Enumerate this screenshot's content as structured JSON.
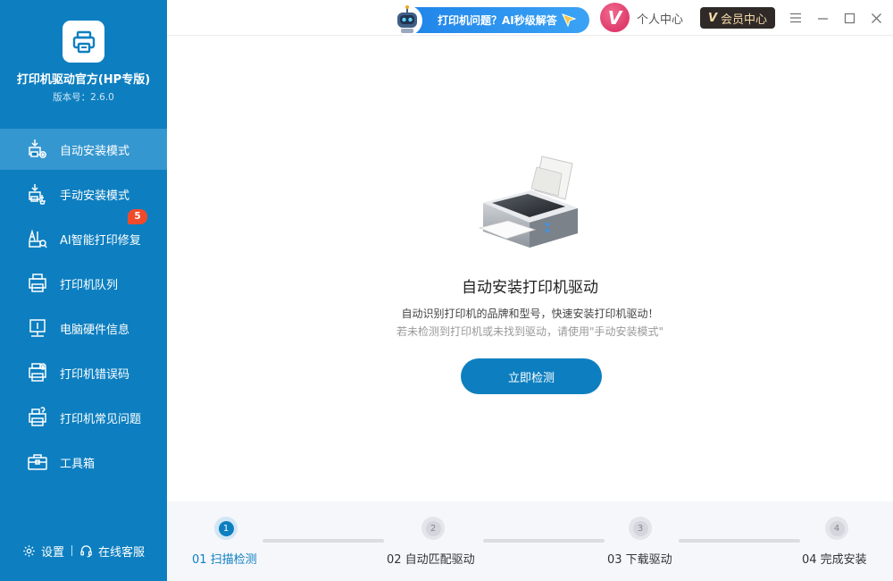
{
  "app": {
    "title": "打印机驱动官方(HP专版)",
    "version_label": "版本号：",
    "version_value": "2.6.0"
  },
  "sidebar": {
    "items": [
      {
        "label": "自动安装模式",
        "icon": "auto-install-icon",
        "active": true
      },
      {
        "label": "手动安装模式",
        "icon": "manual-install-icon"
      },
      {
        "label": "AI智能打印修复",
        "icon": "ai-repair-icon",
        "badge": "5"
      },
      {
        "label": "打印机队列",
        "icon": "printer-queue-icon"
      },
      {
        "label": "电脑硬件信息",
        "icon": "hardware-info-icon"
      },
      {
        "label": "打印机错误码",
        "icon": "printer-error-icon"
      },
      {
        "label": "打印机常见问题",
        "icon": "printer-faq-icon"
      },
      {
        "label": "工具箱",
        "icon": "toolbox-icon"
      }
    ],
    "footer": {
      "settings_label": "设置",
      "support_label": "在线客服"
    }
  },
  "topbar": {
    "ai_banner_text": "打印机问题？AI秒级解答",
    "avatar_letter": "V",
    "user_center_label": "个人中心",
    "vip_badge": "V",
    "vip_label": "会员中心"
  },
  "main": {
    "title": "自动安装打印机驱动",
    "desc_primary": "自动识别打印机的品牌和型号，快速安装打印机驱动！",
    "desc_secondary": "若未检测到打印机或未找到驱动，请使用\"手动安装模式\"",
    "detect_button": "立即检测"
  },
  "steps": [
    {
      "number": "1",
      "label": "01 扫描检测",
      "active": true
    },
    {
      "number": "2",
      "label": "02 自动匹配驱动"
    },
    {
      "number": "3",
      "label": "03 下载驱动"
    },
    {
      "number": "4",
      "label": "04 完成安装"
    }
  ],
  "colors": {
    "brand": "#0d7fc0",
    "sidebar_active": "#3597d0",
    "badge": "#f14a2b",
    "vip_bg": "#2f2a28"
  }
}
